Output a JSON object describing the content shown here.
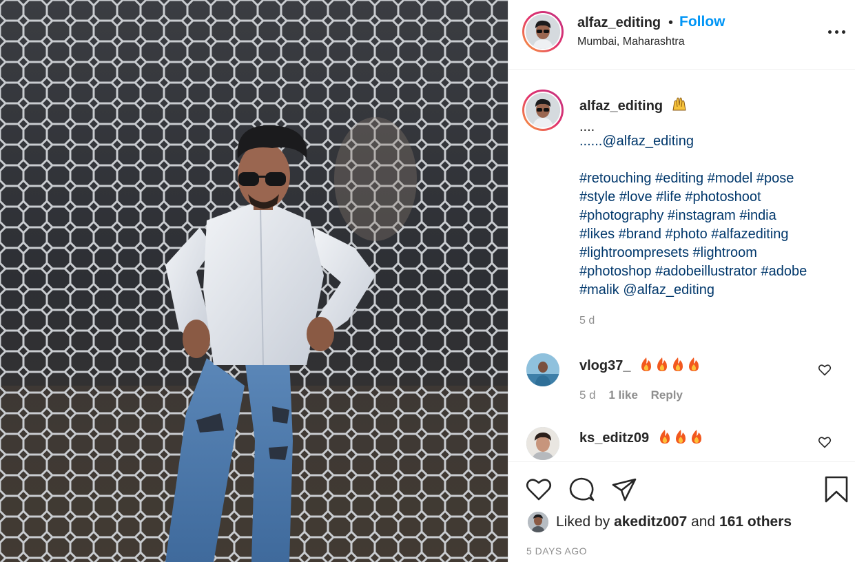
{
  "post": {
    "header": {
      "username": "alfaz_editing",
      "separator": "•",
      "follow_label": "Follow",
      "location": "Mumbai, Maharashtra",
      "more_icon": "more-options-icon"
    },
    "caption": {
      "username": "alfaz_editing",
      "emoji_icon": "raising-hands-emoji",
      "lines": [
        "....",
        "......@alfaz_editing",
        "#retouching #editing #model #pose",
        "#style #love #life #photoshoot",
        "#photography #instagram #india",
        "#likes #brand #photo #alfazediting",
        "#lightroompresets #lightroom",
        "#photoshop #adobeillustrator #adobe",
        "#malik @alfaz_editing"
      ],
      "time": "5 d"
    },
    "comments": [
      {
        "username": "vlog37_",
        "emoji_icon": "fire-emoji",
        "emoji_count": 4,
        "time": "5 d",
        "likes": "1 like",
        "reply_label": "Reply",
        "like_icon": "heart-outline-icon"
      },
      {
        "username": "ks_editz09",
        "emoji_icon": "fire-emoji",
        "emoji_count": 3,
        "like_icon": "heart-outline-icon"
      }
    ],
    "actions": {
      "like_icon": "heart-outline-icon",
      "comment_icon": "comment-bubble-icon",
      "share_icon": "paper-plane-icon",
      "save_icon": "bookmark-icon"
    },
    "likes": {
      "prefix": "Liked by ",
      "liker": "akeditz007",
      "middle": " and ",
      "others": "161 others"
    },
    "date": "5 DAYS AGO"
  },
  "colors": {
    "link_blue": "#0095f6",
    "hashtag_blue": "#00376b",
    "secondary_text": "#8e8e8e",
    "primary_text": "#262626",
    "divider": "#efefef"
  }
}
